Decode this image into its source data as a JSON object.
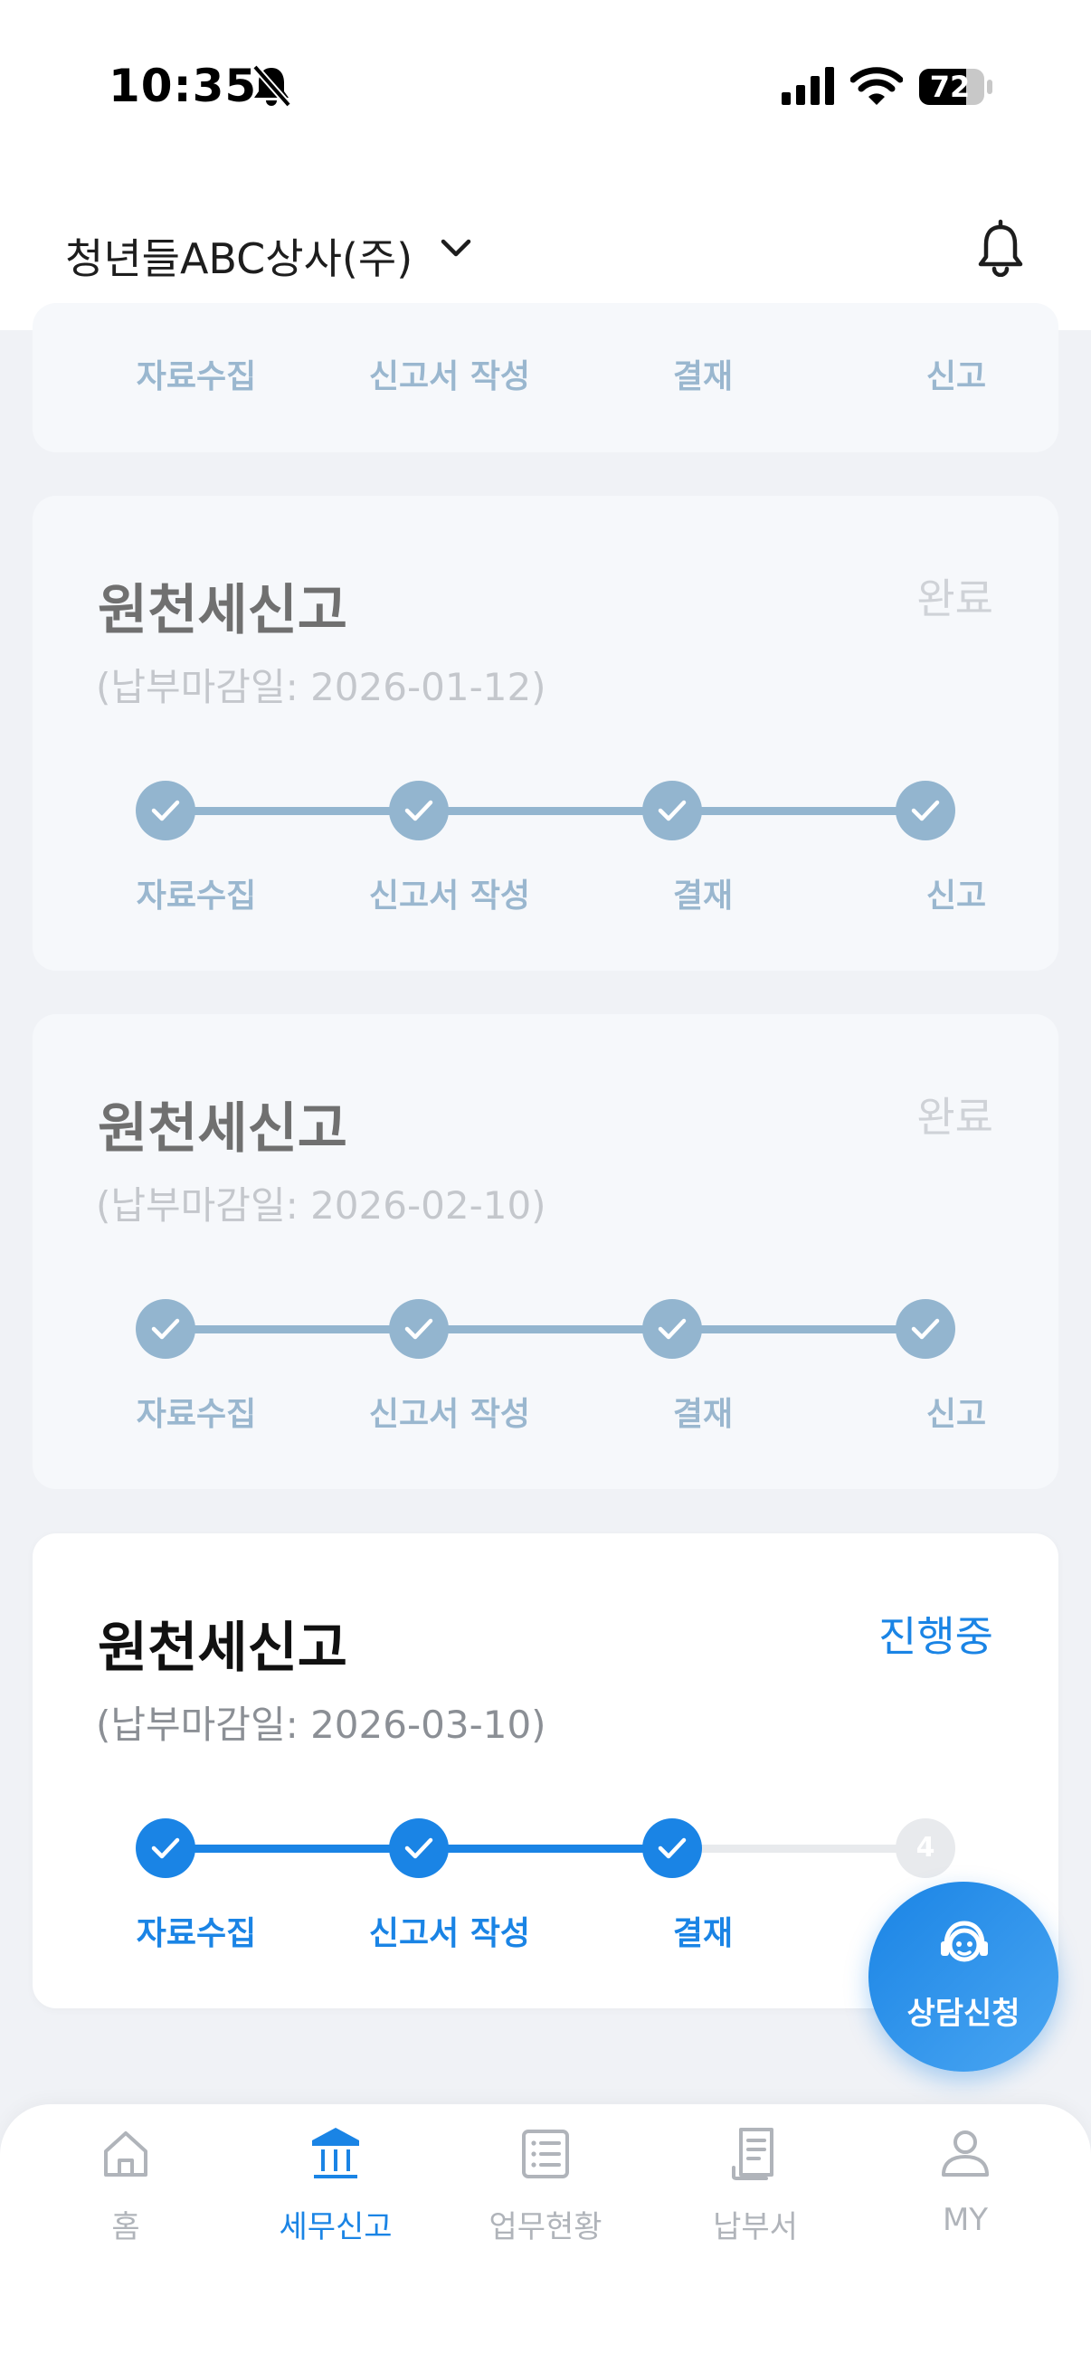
{
  "status_bar": {
    "time": "10:35",
    "battery": "72"
  },
  "header": {
    "company": "청년들ABC상사(주)"
  },
  "step_labels": [
    "자료수집",
    "신고서 작성",
    "결재",
    "신고"
  ],
  "cards": [
    {
      "title": "",
      "status": "",
      "deadline": "",
      "state": "done"
    },
    {
      "title": "원천세신고",
      "status": "완료",
      "deadline": "(납부마감일: 2026-01-12)",
      "state": "done"
    },
    {
      "title": "원천세신고",
      "status": "완료",
      "deadline": "(납부마감일: 2026-02-10)",
      "state": "done"
    },
    {
      "title": "원천세신고",
      "status": "진행중",
      "deadline": "(납부마감일: 2026-03-10)",
      "state": "active",
      "completed_steps": 3,
      "pending_step_number": "4"
    }
  ],
  "fab": {
    "label": "상담신청"
  },
  "nav": {
    "items": [
      {
        "label": "홈",
        "icon": "home-icon"
      },
      {
        "label": "세무신고",
        "icon": "bank-icon",
        "active": true
      },
      {
        "label": "업무현황",
        "icon": "list-icon"
      },
      {
        "label": "납부서",
        "icon": "receipt-icon"
      },
      {
        "label": "MY",
        "icon": "person-icon"
      }
    ]
  },
  "colors": {
    "accent": "#1a84e5",
    "done_step": "#93b5cf",
    "pending_step": "#e8eaed"
  }
}
